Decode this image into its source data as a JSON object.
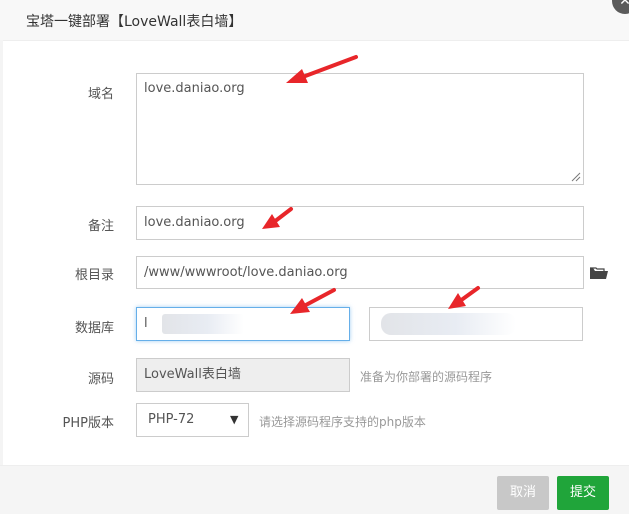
{
  "dialog": {
    "title": "宝塔一键部署【LoveWall表白墙】",
    "close_icon": "close-icon"
  },
  "form": {
    "domain": {
      "label": "域名",
      "value": "love.daniao.org"
    },
    "remark": {
      "label": "备注",
      "value": "love.daniao.org"
    },
    "root_dir": {
      "label": "根目录",
      "value": "/www/wwwroot/love.daniao.org",
      "icon": "folder-icon"
    },
    "database": {
      "label": "数据库",
      "name_value": "l"
    },
    "source": {
      "label": "源码",
      "value": "LoveWall表白墙",
      "hint": "准备为你部署的源码程序"
    },
    "php": {
      "label": "PHP版本",
      "selected": "PHP-72",
      "hint": "请选择源码程序支持的php版本"
    }
  },
  "footer": {
    "cancel_label": "取消",
    "submit_label": "提交"
  },
  "colors": {
    "submit": "#20a53a",
    "cancel_disabled": "#c8c8c8",
    "annotation_arrow": "#e8262a",
    "focus_border": "#66afe9"
  }
}
